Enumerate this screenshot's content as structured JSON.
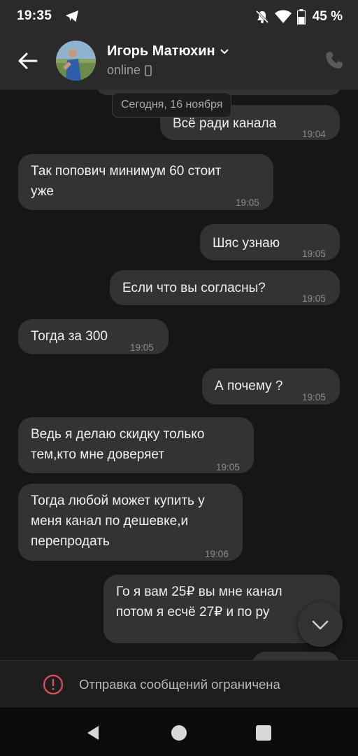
{
  "status_bar": {
    "time": "19:35",
    "battery": "45 %"
  },
  "header": {
    "name": "Игорь Матюхин",
    "status": "online"
  },
  "chat": {
    "date_chip": "Сегодня, 16 ноября",
    "messages": [
      {
        "text": "Всё ради канала",
        "time": "19:04",
        "side": "out"
      },
      {
        "text": "Так попович минимум 60 стоит уже",
        "time": "19:05",
        "side": "in"
      },
      {
        "text": "Шяс узнаю",
        "time": "19:05",
        "side": "out"
      },
      {
        "text": "Если что вы согласны?",
        "time": "19:05",
        "side": "out"
      },
      {
        "text": "Тогда за 300",
        "time": "19:05",
        "side": "in"
      },
      {
        "text": "А почему ?",
        "time": "19:05",
        "side": "out"
      },
      {
        "text": "Ведь я делаю скидку только тем,кто мне доверяет",
        "time": "19:05",
        "side": "in"
      },
      {
        "text": "Тогда любой может купить у меня канал по дешевке,и перепродать",
        "time": "19:06",
        "side": "in"
      },
      {
        "text": "Го я вам 25₽ вы мне канал потом я есчё 27₽ и по ру",
        "time": "",
        "side": "out"
      }
    ]
  },
  "restriction": {
    "text": "Отправка сообщений ограничена"
  },
  "colors": {
    "bubble": "#333333",
    "background": "#161616",
    "header": "#2a2a2a",
    "warning": "#e0505a"
  }
}
